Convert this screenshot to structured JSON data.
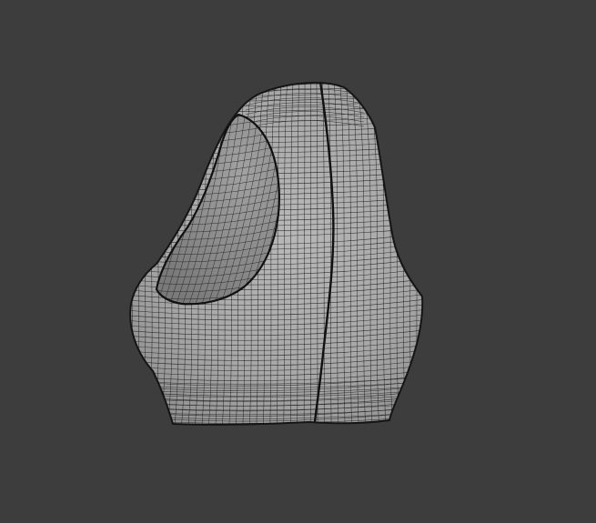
{
  "viewport": {
    "background_color": "#3d3d3d",
    "object": {
      "name": "",
      "shading": "solid-wireframe",
      "surface_color": "#a9a9a9",
      "inner_color": "#8c8c8c",
      "wire_color": "#1c1c1c",
      "seam_color": "#111111"
    }
  }
}
